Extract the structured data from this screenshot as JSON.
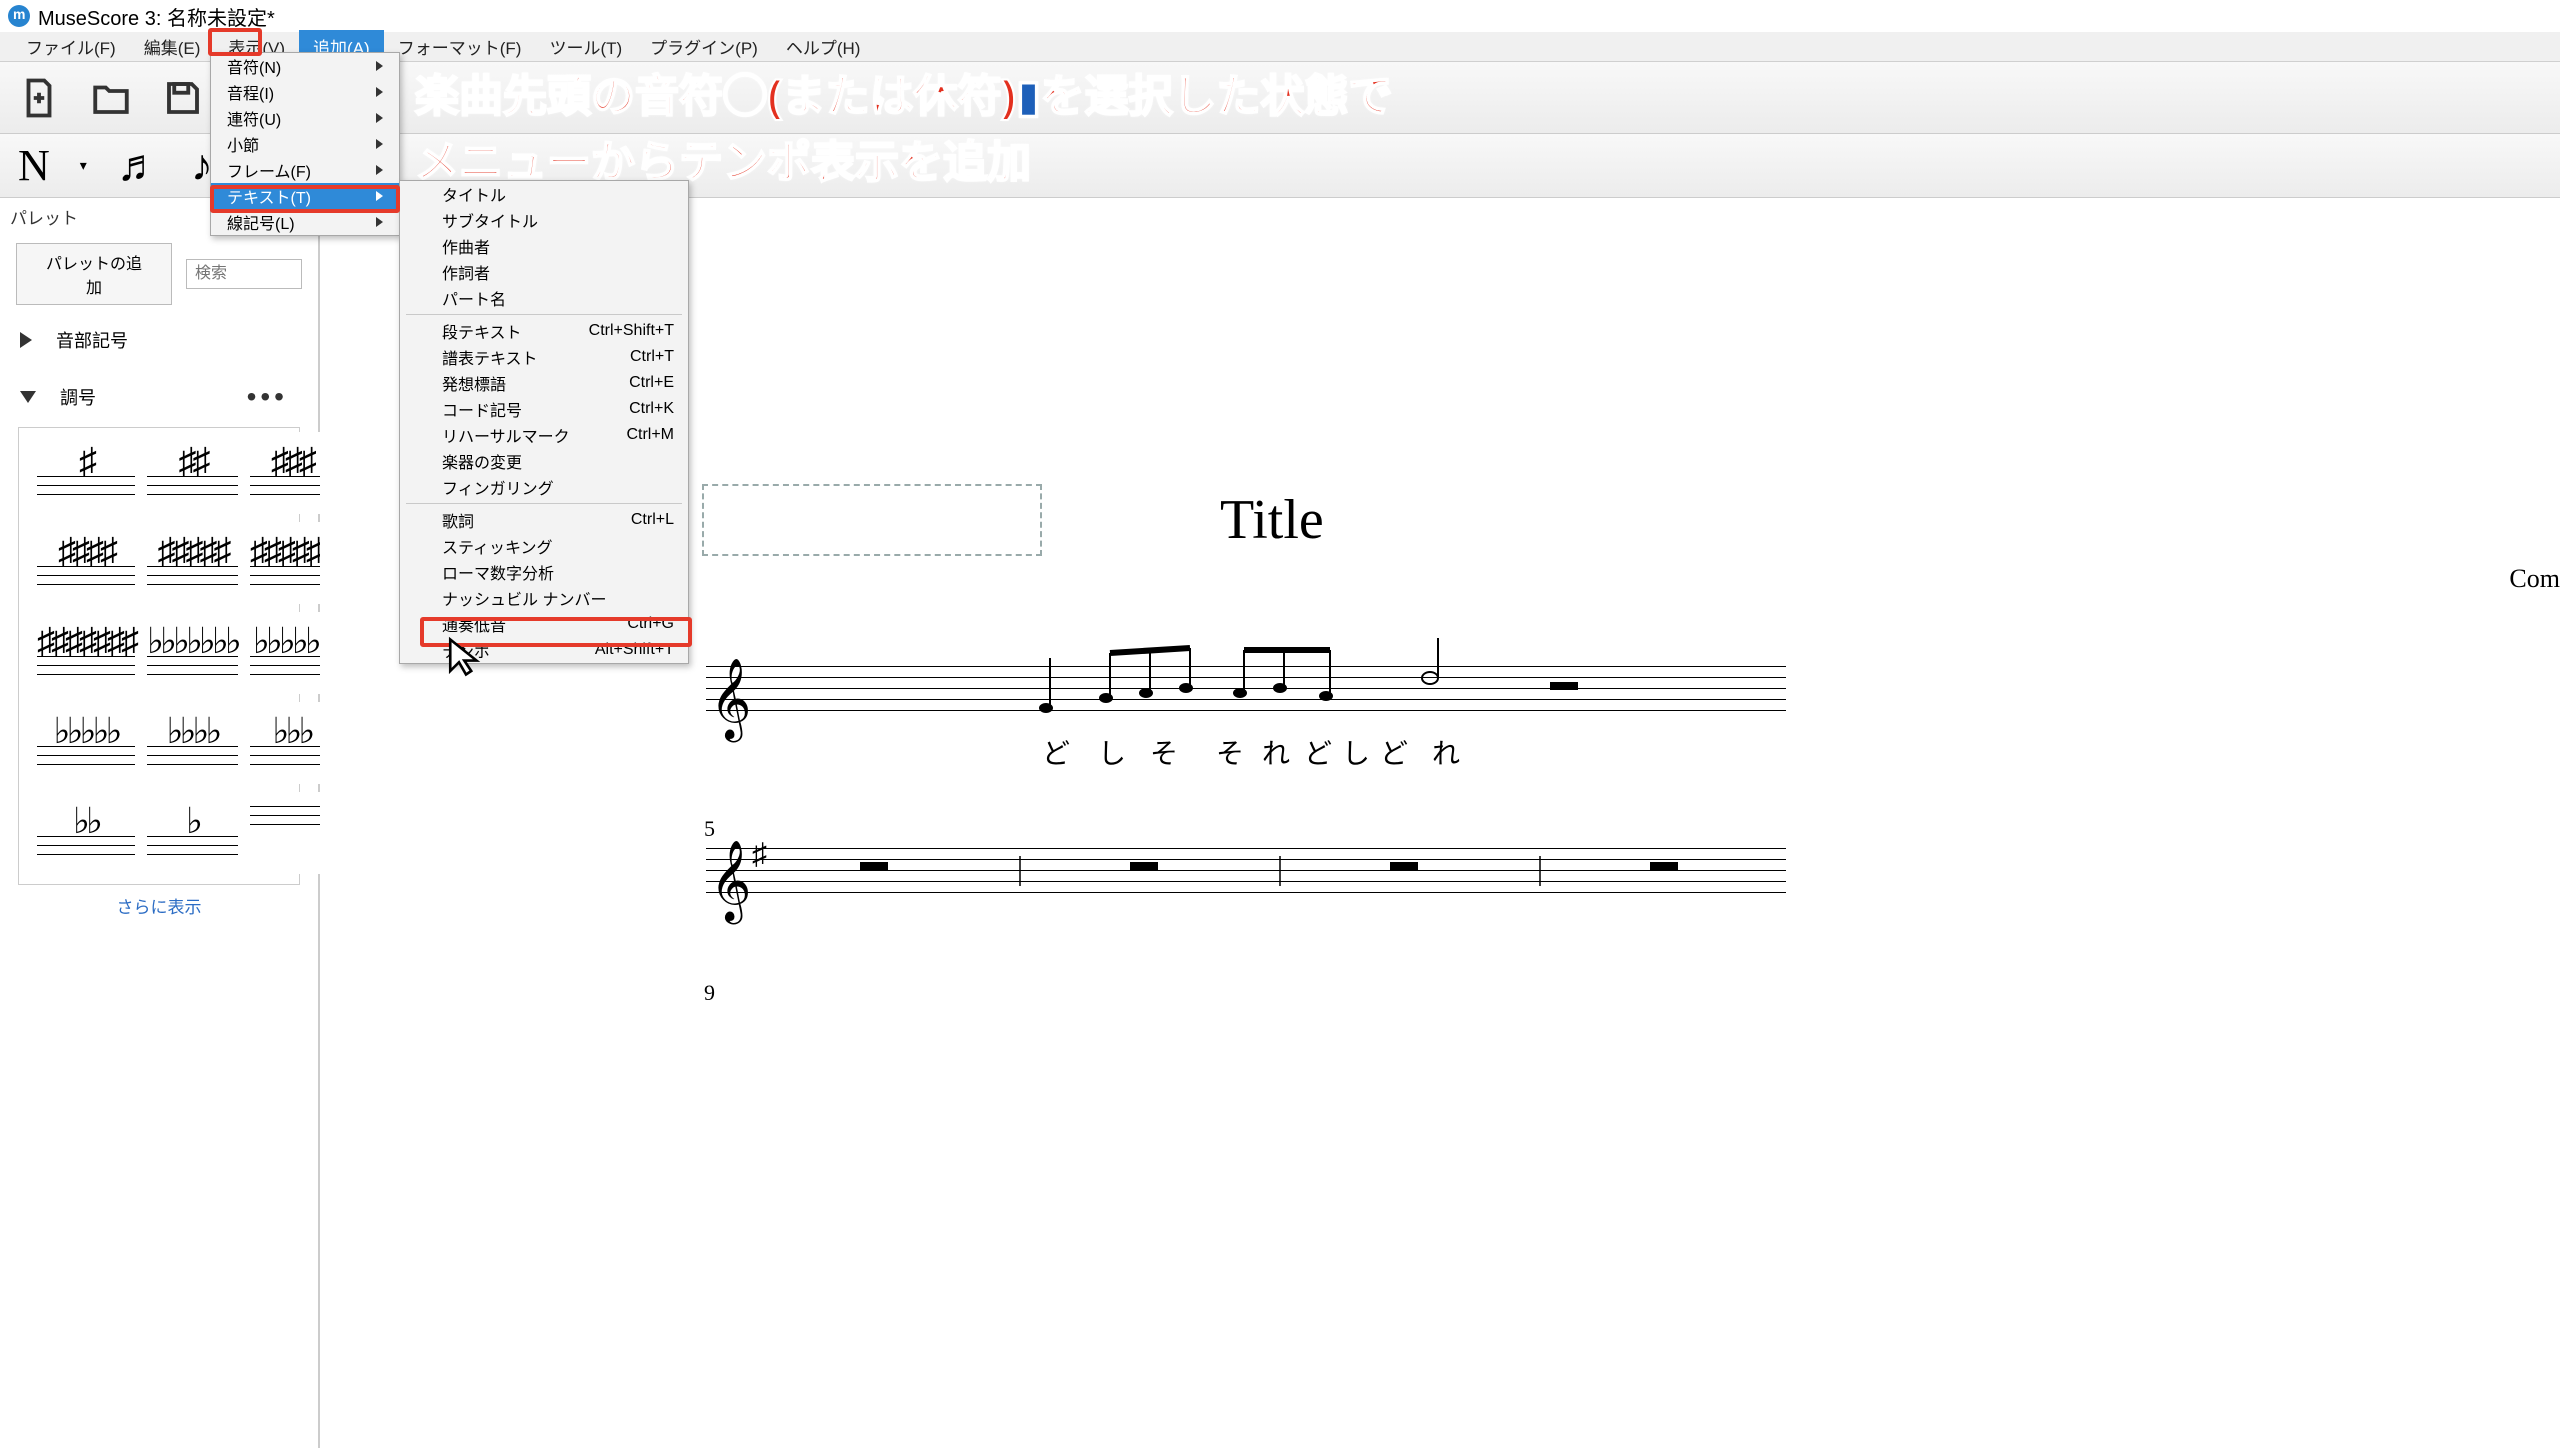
{
  "title": "MuseScore 3: 名称未設定*",
  "menubar": [
    "ファイル(F)",
    "編集(E)",
    "表示(V)",
    "追加(A)",
    "フォーマット(F)",
    "ツール(T)",
    "プラグイン(P)",
    "ヘルプ(H)"
  ],
  "active_menu_index": 3,
  "dropdown1": [
    {
      "label": "音符(N)",
      "arrow": true
    },
    {
      "label": "音程(I)",
      "arrow": true
    },
    {
      "label": "連符(U)",
      "arrow": true
    },
    {
      "label": "小節",
      "arrow": true
    },
    {
      "label": "フレーム(F)",
      "arrow": true
    },
    {
      "label": "テキスト(T)",
      "arrow": true,
      "selected": true
    },
    {
      "label": "線記号(L)",
      "arrow": true
    }
  ],
  "dropdown2": [
    {
      "label": "タイトル"
    },
    {
      "label": "サブタイトル"
    },
    {
      "label": "作曲者"
    },
    {
      "label": "作詞者"
    },
    {
      "label": "パート名"
    },
    {
      "sep": true
    },
    {
      "label": "段テキスト",
      "short": "Ctrl+Shift+T"
    },
    {
      "label": "譜表テキスト",
      "short": "Ctrl+T"
    },
    {
      "label": "発想標語",
      "short": "Ctrl+E"
    },
    {
      "label": "コード記号",
      "short": "Ctrl+K"
    },
    {
      "label": "リハーサルマーク",
      "short": "Ctrl+M"
    },
    {
      "label": "楽器の変更"
    },
    {
      "label": "フィンガリング"
    },
    {
      "sep": true
    },
    {
      "label": "歌詞",
      "short": "Ctrl+L"
    },
    {
      "label": "スティッキング"
    },
    {
      "label": "ローマ数字分析"
    },
    {
      "label": "ナッシュビル ナンバー"
    },
    {
      "label": "通奏低音",
      "short": "Ctrl+G"
    },
    {
      "label": "テンポ",
      "short": "Alt+Shift+T"
    }
  ],
  "sidebar": {
    "header": "パレット",
    "add_btn": "パレットの追加",
    "search_ph": "検索",
    "sections": [
      "音部記号",
      "調号"
    ],
    "more": "さらに表示"
  },
  "score": {
    "title": "Title",
    "composer": "Com",
    "lyrics": [
      "ど",
      "し",
      "そ",
      "そ",
      "れ",
      "ど",
      "し",
      "ど",
      "れ"
    ],
    "measure5": "5",
    "measure9": "9"
  },
  "annotation": {
    "line1a": "楽曲先頭の音符",
    "line1b": "(または休符)",
    "line1c": "を選択した状態で",
    "line2": "メニューからテンポ表示を追加"
  }
}
